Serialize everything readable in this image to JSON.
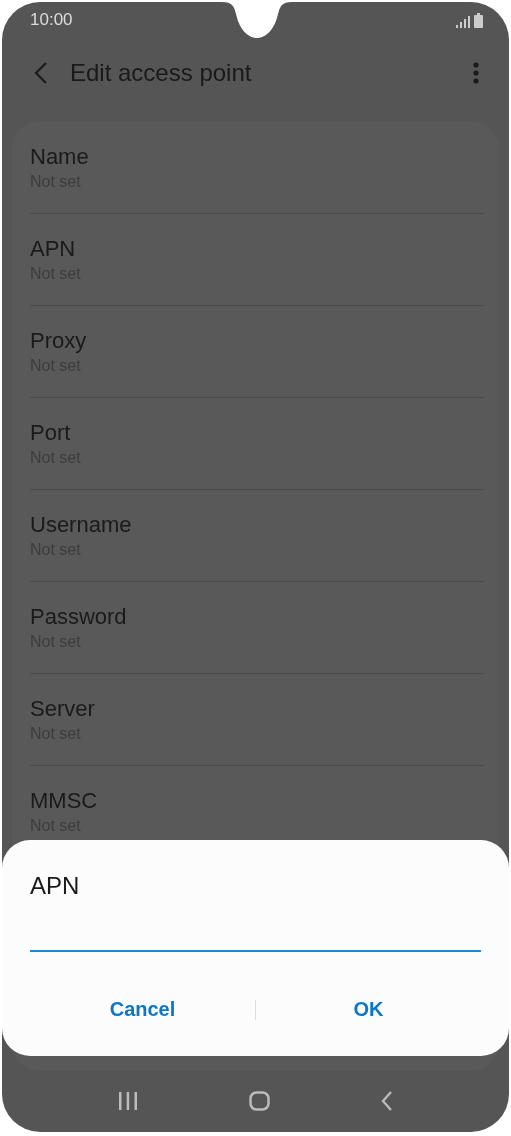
{
  "status_bar": {
    "time": "10:00"
  },
  "header": {
    "title": "Edit access point"
  },
  "settings": [
    {
      "label": "Name",
      "value": "Not set"
    },
    {
      "label": "APN",
      "value": "Not set"
    },
    {
      "label": "Proxy",
      "value": "Not set"
    },
    {
      "label": "Port",
      "value": "Not set"
    },
    {
      "label": "Username",
      "value": "Not set"
    },
    {
      "label": "Password",
      "value": "Not set"
    },
    {
      "label": "Server",
      "value": "Not set"
    },
    {
      "label": "MMSC",
      "value": "Not set"
    }
  ],
  "dialog": {
    "title": "APN",
    "field": {
      "focused": true
    },
    "buttons": [
      "Cancel",
      "OK"
    ]
  }
}
